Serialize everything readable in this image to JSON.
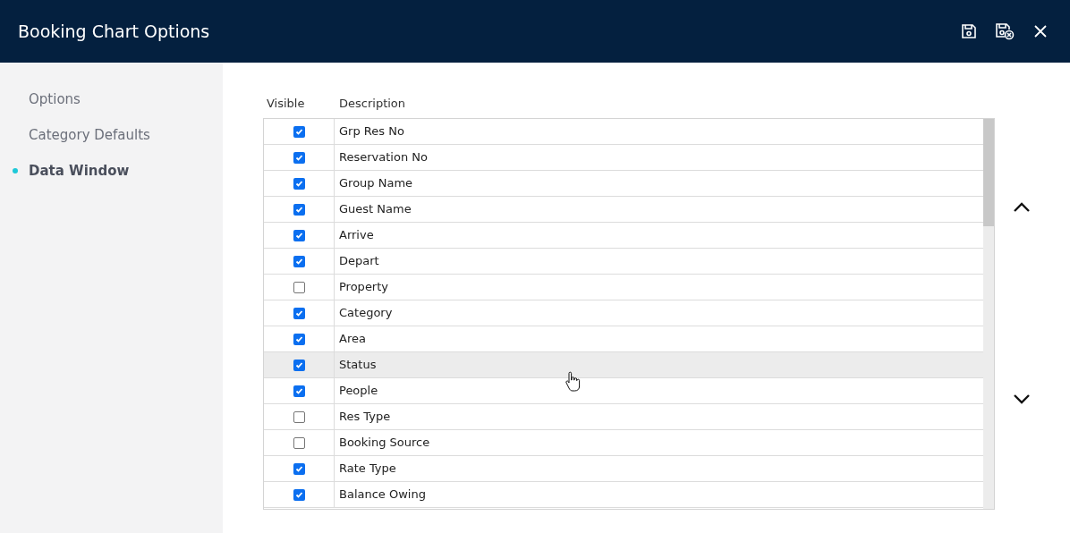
{
  "window": {
    "title": "Booking Chart Options"
  },
  "sidebar": {
    "items": [
      {
        "label": "Options",
        "selected": false
      },
      {
        "label": "Category Defaults",
        "selected": false
      },
      {
        "label": "Data Window",
        "selected": true
      }
    ]
  },
  "table": {
    "columns": [
      "Visible",
      "Description"
    ],
    "rows": [
      {
        "description": "Grp Res No",
        "checked": true,
        "hovered": false
      },
      {
        "description": "Reservation No",
        "checked": true,
        "hovered": false
      },
      {
        "description": "Group Name",
        "checked": true,
        "hovered": false
      },
      {
        "description": "Guest Name",
        "checked": true,
        "hovered": false
      },
      {
        "description": "Arrive",
        "checked": true,
        "hovered": false
      },
      {
        "description": "Depart",
        "checked": true,
        "hovered": false
      },
      {
        "description": "Property",
        "checked": false,
        "hovered": false
      },
      {
        "description": "Category",
        "checked": true,
        "hovered": false
      },
      {
        "description": "Area",
        "checked": true,
        "hovered": false
      },
      {
        "description": "Status",
        "checked": true,
        "hovered": true
      },
      {
        "description": "People",
        "checked": true,
        "hovered": false
      },
      {
        "description": "Res Type",
        "checked": false,
        "hovered": false
      },
      {
        "description": "Booking Source",
        "checked": false,
        "hovered": false
      },
      {
        "description": "Rate Type",
        "checked": true,
        "hovered": false
      },
      {
        "description": "Balance Owing",
        "checked": true,
        "hovered": false
      }
    ]
  }
}
